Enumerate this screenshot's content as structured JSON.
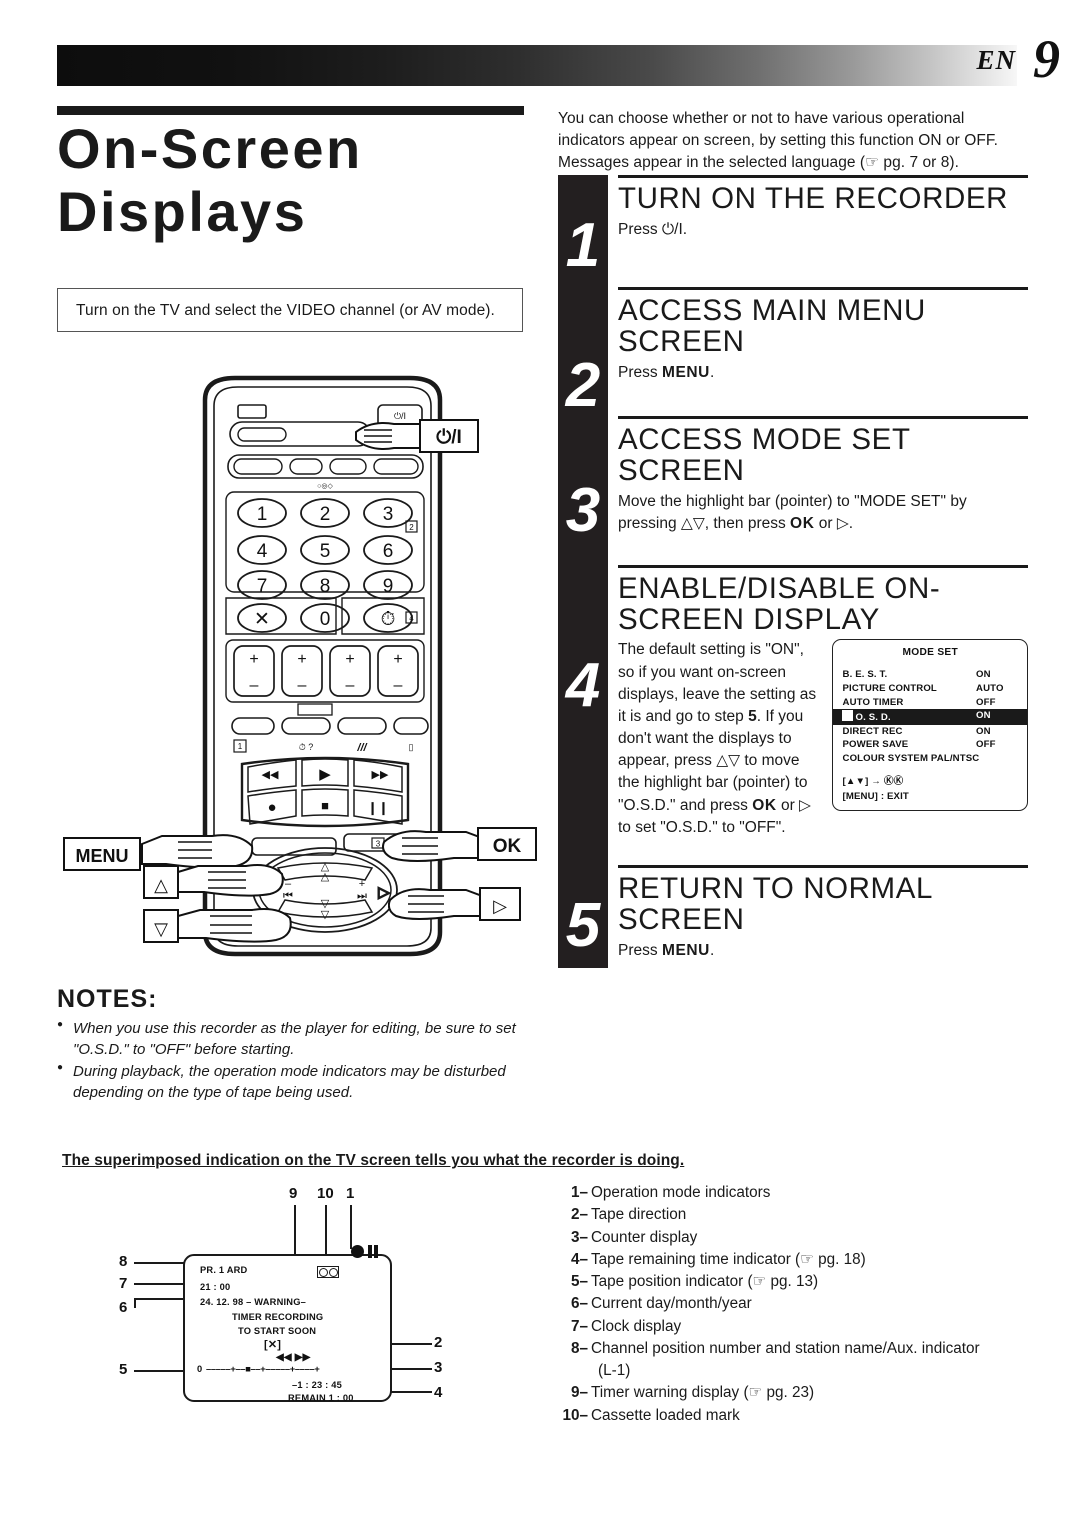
{
  "header": {
    "lang_code": "EN",
    "page_number": "9"
  },
  "left": {
    "title_line1": "On-Screen",
    "title_line2": "Displays",
    "tip": "Turn on the TV and select the VIDEO channel (or AV mode)."
  },
  "intro": "You can choose whether or not to have various operational indicators appear on screen, by setting this function ON or OFF. Messages appear in the selected language (☞ pg. 7 or 8).",
  "steps": [
    {
      "num": "1",
      "heading": "TURN ON THE RECORDER",
      "body": "Press ⏻/I."
    },
    {
      "num": "2",
      "heading": "ACCESS MAIN MENU SCREEN",
      "body": "Press MENU."
    },
    {
      "num": "3",
      "heading": "ACCESS MODE SET SCREEN",
      "body": "Move the highlight bar (pointer) to \"MODE SET\" by pressing △▽, then press OK or ▷."
    },
    {
      "num": "4",
      "heading": "ENABLE/DISABLE ON-SCREEN DISPLAY",
      "body": "The default setting is \"ON\", so if you want on-screen displays, leave the setting as it is and go to step 5. If you don't want the displays to appear, press △▽ to move the highlight bar (pointer) to \"O.S.D.\" and press OK or ▷ to set \"O.S.D.\" to \"OFF\"."
    },
    {
      "num": "5",
      "heading": "RETURN TO NORMAL SCREEN",
      "body": "Press MENU."
    }
  ],
  "mode_set": {
    "title": "MODE SET",
    "rows": [
      {
        "name": "B. E. S. T.",
        "value": "ON",
        "highlighted": false
      },
      {
        "name": "PICTURE CONTROL",
        "value": "AUTO",
        "highlighted": false
      },
      {
        "name": "AUTO TIMER",
        "value": "OFF",
        "highlighted": false
      },
      {
        "name": "O. S. D.",
        "value": "ON",
        "highlighted": true
      },
      {
        "name": "DIRECT REC",
        "value": "ON",
        "highlighted": false
      },
      {
        "name": "POWER SAVE",
        "value": "OFF",
        "highlighted": false
      }
    ],
    "wide_row": "COLOUR SYSTEM PAL/NTSC",
    "footer_1": "[▲▼] → ⓀⓀ",
    "footer_2": "[MENU] : EXIT"
  },
  "notes": {
    "heading": "NOTES:",
    "items": [
      "When you use this recorder as the player for editing, be sure to set \"O.S.D.\" to  \"OFF\" before starting.",
      "During playback, the operation mode indicators may be disturbed depending on the type of tape being used."
    ]
  },
  "bottom": {
    "superimposed_heading": "The superimposed indication on the TV screen tells you what the recorder is doing.",
    "legend": [
      {
        "n": "1–",
        "d": "Operation mode indicators"
      },
      {
        "n": "2–",
        "d": "Tape direction"
      },
      {
        "n": "3–",
        "d": "Counter display"
      },
      {
        "n": "4–",
        "d": "Tape remaining time indicator (☞ pg. 18)"
      },
      {
        "n": "5–",
        "d": "Tape position indicator (☞ pg. 13)"
      },
      {
        "n": "6–",
        "d": "Current day/month/year"
      },
      {
        "n": "7–",
        "d": "Clock display"
      },
      {
        "n": "8–",
        "d": "Channel position number and station name/Aux. indicator"
      },
      {
        "n": "9–",
        "d": "Timer warning display (☞ pg. 23)"
      },
      {
        "n": "10–",
        "d": "Cassette loaded mark"
      }
    ],
    "legend_8_cont": "(L-1)"
  },
  "tv_screen": {
    "channel": "PR.  1 ARD",
    "clock": "21 : 00",
    "date_warning": "24. 12. 98 – WARNING–",
    "msg_line1": "TIMER RECORDING",
    "msg_line2": "TO START SOON",
    "msg_line3": "[✕]",
    "tape_dir": "◀◀ ▶▶",
    "position_bar_zero": "0",
    "position_bar": "–––––+––■––+–––––+––––+",
    "counter": "–1 : 23 : 45",
    "remain": "REMAIN 1 : 00",
    "callouts_top": [
      "9",
      "10",
      "1"
    ],
    "callouts_left": [
      "8",
      "7",
      "6",
      "5"
    ],
    "callouts_right": [
      "2",
      "3",
      "4"
    ]
  },
  "remote_callouts": {
    "power": "⏻/I",
    "menu": "MENU",
    "ok": "OK",
    "up": "△",
    "down": "▽",
    "right": "▷"
  }
}
